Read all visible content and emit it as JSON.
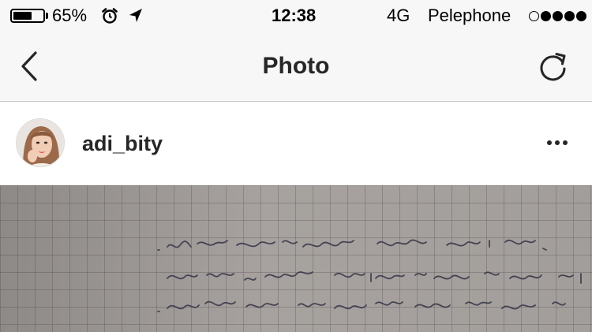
{
  "status_bar": {
    "battery_percent": "65%",
    "battery_level": 0.65,
    "time": "12:38",
    "network": "4G",
    "carrier": "Pelephone",
    "signal_strength": 4,
    "icons": [
      "battery-icon",
      "alarm-icon",
      "location-arrow-icon"
    ]
  },
  "nav": {
    "title": "Photo",
    "back_icon": "chevron-left-icon",
    "refresh_icon": "refresh-icon"
  },
  "post": {
    "username": "adi_bity",
    "more_icon": "ellipsis-icon",
    "image": "handwritten note on grid paper"
  },
  "colors": {
    "bar_background": "#f7f7f7",
    "text_primary": "#262626",
    "divider": "#c8c8cc",
    "paper": "#9d9895",
    "ink": "#3b3a4a"
  }
}
